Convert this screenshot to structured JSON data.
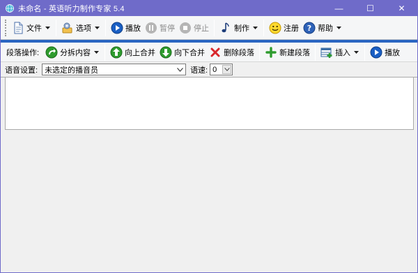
{
  "window": {
    "title": "未命名 - 英语听力制作专家 5.4",
    "controls": {
      "minimize": "—",
      "maximize": "☐",
      "close": "✕"
    },
    "accent_color": "#6f6bc9"
  },
  "main_toolbar": {
    "file_label": "文件",
    "options_label": "选项",
    "play_label": "播放",
    "pause_label": "暂停",
    "stop_label": "停止",
    "make_label": "制作",
    "register_label": "注册",
    "help_label": "帮助"
  },
  "paragraph_toolbar": {
    "label": "段落操作:",
    "split_label": "分拆内容",
    "merge_up_label": "向上合并",
    "merge_down_label": "向下合并",
    "delete_label": "删除段落",
    "new_label": "新建段落",
    "insert_label": "插入",
    "play_label": "播放"
  },
  "voice_settings": {
    "label": "语音设置:",
    "voice_value": "未选定的播音员",
    "speed_label": "语速:",
    "speed_value": "0"
  },
  "colors": {
    "blue_divider": "#2a66c2",
    "play_blue": "#1a5fc4",
    "green": "#2e9b2e",
    "red": "#d8262b"
  }
}
